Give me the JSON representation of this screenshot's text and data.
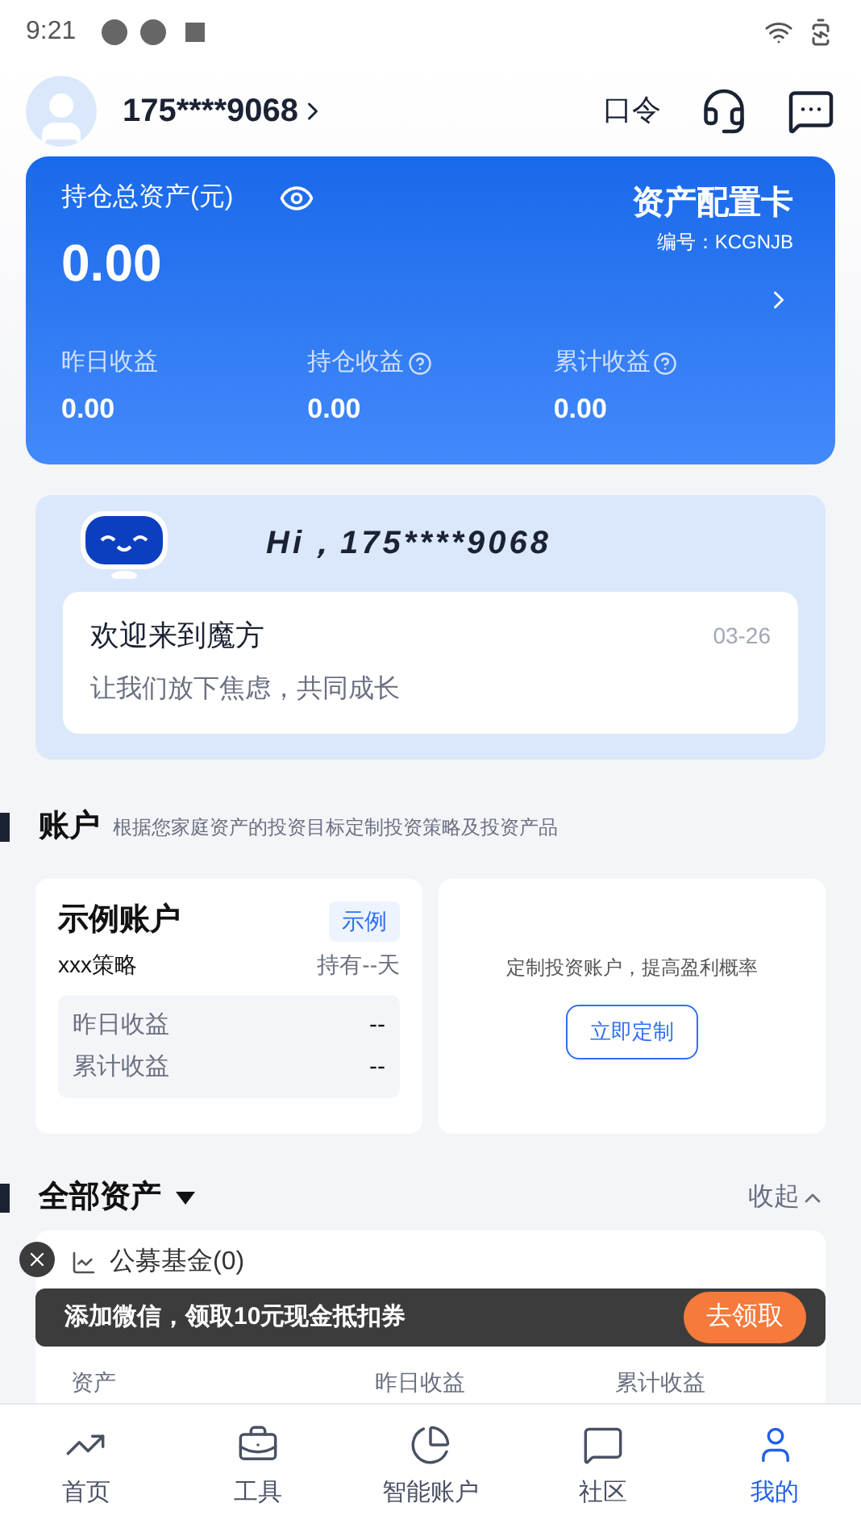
{
  "status_bar": {
    "time": "9:21"
  },
  "header": {
    "phone": "175****9068",
    "command": "口令"
  },
  "asset_card": {
    "title": "持仓总资产(元)",
    "amount": "0.00",
    "config_title": "资产配置卡",
    "code": "编号：KCGNJB",
    "stats": [
      {
        "label": "昨日收益",
        "value": "0.00",
        "help": false
      },
      {
        "label": "持仓收益",
        "value": "0.00",
        "help": true
      },
      {
        "label": "累计收益",
        "value": "0.00",
        "help": true
      }
    ]
  },
  "greeting": {
    "hi": "Hi，175****9068",
    "title": "欢迎来到魔方",
    "body": "让我们放下焦虑，共同成长",
    "date": "03-26"
  },
  "account_section": {
    "title": "账户",
    "subtitle": "根据您家庭资产的投资目标定制投资策略及投资产品",
    "sample": {
      "name": "示例账户",
      "tag": "示例",
      "strategy": "xxx策略",
      "holding": "持有--天",
      "rows": [
        {
          "label": "昨日收益",
          "value": "--"
        },
        {
          "label": "累计收益",
          "value": "--"
        }
      ]
    },
    "custom": {
      "text": "定制投资账户，提高盈利概率",
      "button": "立即定制"
    }
  },
  "all_assets": {
    "title": "全部资产",
    "collapse": "收起",
    "fund": {
      "title": "公募基金(0)",
      "columns": [
        "资产",
        "昨日收益",
        "累计收益"
      ]
    }
  },
  "toast": {
    "text": "添加微信，领取10元现金抵扣券",
    "button": "去领取"
  },
  "nav": [
    {
      "label": "首页",
      "selected": false
    },
    {
      "label": "工具",
      "selected": false
    },
    {
      "label": "智能账户",
      "selected": false
    },
    {
      "label": "社区",
      "selected": false
    },
    {
      "label": "我的",
      "selected": true
    }
  ]
}
